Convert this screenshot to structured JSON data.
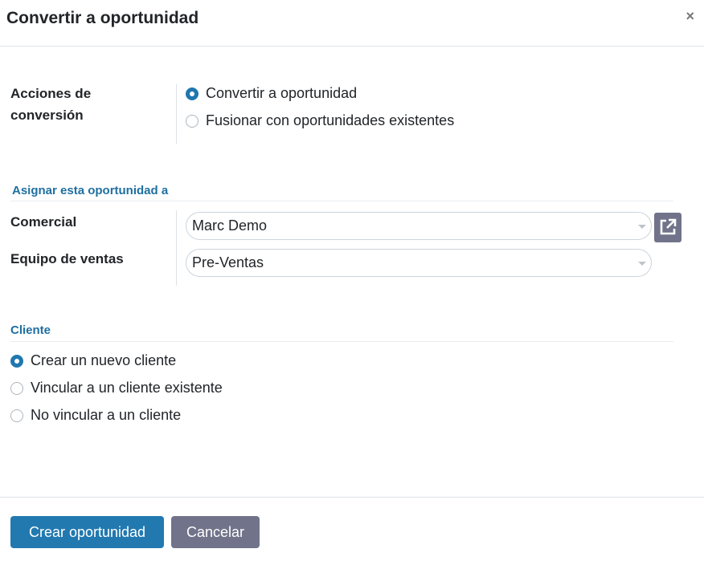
{
  "dialog": {
    "title": "Convertir a oportunidad",
    "close_label": "×"
  },
  "conversion": {
    "label": "Acciones de conversión",
    "options": [
      {
        "label": "Convertir a oportunidad",
        "checked": true
      },
      {
        "label": "Fusionar con oportunidades existentes",
        "checked": false
      }
    ]
  },
  "assign": {
    "section_title": "Asignar esta oportunidad a",
    "salesperson_label": "Comercial",
    "salesperson_value": "Marc Demo",
    "team_label": "Equipo de ventas",
    "team_value": "Pre-Ventas"
  },
  "customer": {
    "section_title": "Cliente",
    "options": [
      {
        "label": "Crear un nuevo cliente",
        "checked": true
      },
      {
        "label": "Vincular a un cliente existente",
        "checked": false
      },
      {
        "label": "No vincular a un cliente",
        "checked": false
      }
    ]
  },
  "footer": {
    "primary_label": "Crear oportunidad",
    "secondary_label": "Cancelar"
  },
  "colors": {
    "primary": "#2279b0",
    "secondary": "#71738a",
    "section_title": "#1f6fa0"
  },
  "icons": {
    "close": "close-icon",
    "external": "external-link-icon",
    "dropdown": "chevron-down-icon"
  }
}
